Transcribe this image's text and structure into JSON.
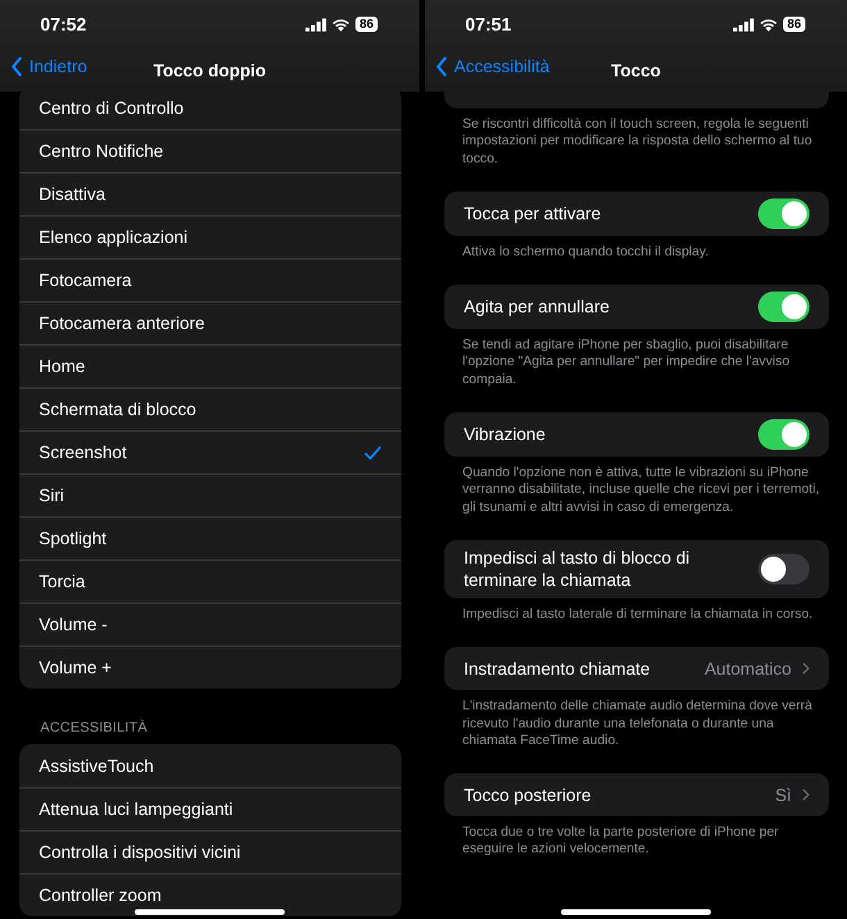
{
  "screens": [
    {
      "status_bar": {
        "time": "07:52",
        "battery": "86"
      },
      "nav": {
        "back": "Indietro",
        "title": "Tocco doppio"
      },
      "groups": [
        {
          "rows": [
            {
              "kind": "check",
              "label": "Centro di Controllo",
              "checked": false
            },
            {
              "kind": "check",
              "label": "Centro Notifiche",
              "checked": false
            },
            {
              "kind": "check",
              "label": "Disattiva",
              "checked": false
            },
            {
              "kind": "check",
              "label": "Elenco applicazioni",
              "checked": false
            },
            {
              "kind": "check",
              "label": "Fotocamera",
              "checked": false
            },
            {
              "kind": "check",
              "label": "Fotocamera anteriore",
              "checked": false
            },
            {
              "kind": "check",
              "label": "Home",
              "checked": false
            },
            {
              "kind": "check",
              "label": "Schermata di blocco",
              "checked": false
            },
            {
              "kind": "check",
              "label": "Screenshot",
              "checked": true
            },
            {
              "kind": "check",
              "label": "Siri",
              "checked": false
            },
            {
              "kind": "check",
              "label": "Spotlight",
              "checked": false
            },
            {
              "kind": "check",
              "label": "Torcia",
              "checked": false
            },
            {
              "kind": "check",
              "label": "Volume -",
              "checked": false
            },
            {
              "kind": "check",
              "label": "Volume +",
              "checked": false
            }
          ]
        },
        {
          "header": "ACCESSIBILITÀ",
          "rows": [
            {
              "kind": "check",
              "label": "AssistiveTouch",
              "checked": false
            },
            {
              "kind": "check",
              "label": "Attenua luci lampeggianti",
              "checked": false
            },
            {
              "kind": "check",
              "label": "Controlla i dispositivi vicini",
              "checked": false
            },
            {
              "kind": "check",
              "label": "Controller zoom",
              "checked": false
            }
          ]
        }
      ]
    },
    {
      "status_bar": {
        "time": "07:51",
        "battery": "86"
      },
      "nav": {
        "back": "Accessibilità",
        "title": "Tocco"
      },
      "groups": [
        {
          "footer": "Se riscontri difficoltà con il touch screen, regola le seguenti impostazioni per modificare la risposta dello schermo al tuo tocco."
        },
        {
          "rows": [
            {
              "kind": "toggle",
              "label": "Tocca per attivare",
              "on": true
            }
          ],
          "footer": "Attiva lo schermo quando tocchi il display."
        },
        {
          "rows": [
            {
              "kind": "toggle",
              "label": "Agita per annullare",
              "on": true
            }
          ],
          "footer": "Se tendi ad agitare iPhone per sbaglio, puoi disabilitare l'opzione \"Agita per annullare\" per impedire che l'avviso compaia."
        },
        {
          "rows": [
            {
              "kind": "toggle",
              "label": "Vibrazione",
              "on": true
            }
          ],
          "footer": "Quando l'opzione non è attiva, tutte le vibrazioni su iPhone verranno disabilitate, incluse quelle che ricevi per i terremoti, gli tsunami e altri avvisi in caso di emergenza."
        },
        {
          "rows": [
            {
              "kind": "toggle",
              "label": "Impedisci al tasto di blocco di terminare la chiamata",
              "on": false
            }
          ],
          "footer": "Impedisci al tasto laterale di terminare la chiamata in corso."
        },
        {
          "rows": [
            {
              "kind": "link",
              "label": "Instradamento chiamate",
              "value": "Automatico"
            }
          ],
          "footer": "L'instradamento delle chiamate audio determina dove verrà ricevuto l'audio durante una telefonata o durante una chiamata FaceTime audio."
        },
        {
          "rows": [
            {
              "kind": "link",
              "label": "Tocco posteriore",
              "value": "Sì"
            }
          ],
          "footer": "Tocca due o tre volte la parte posteriore di iPhone per eseguire le azioni velocemente."
        }
      ]
    }
  ]
}
